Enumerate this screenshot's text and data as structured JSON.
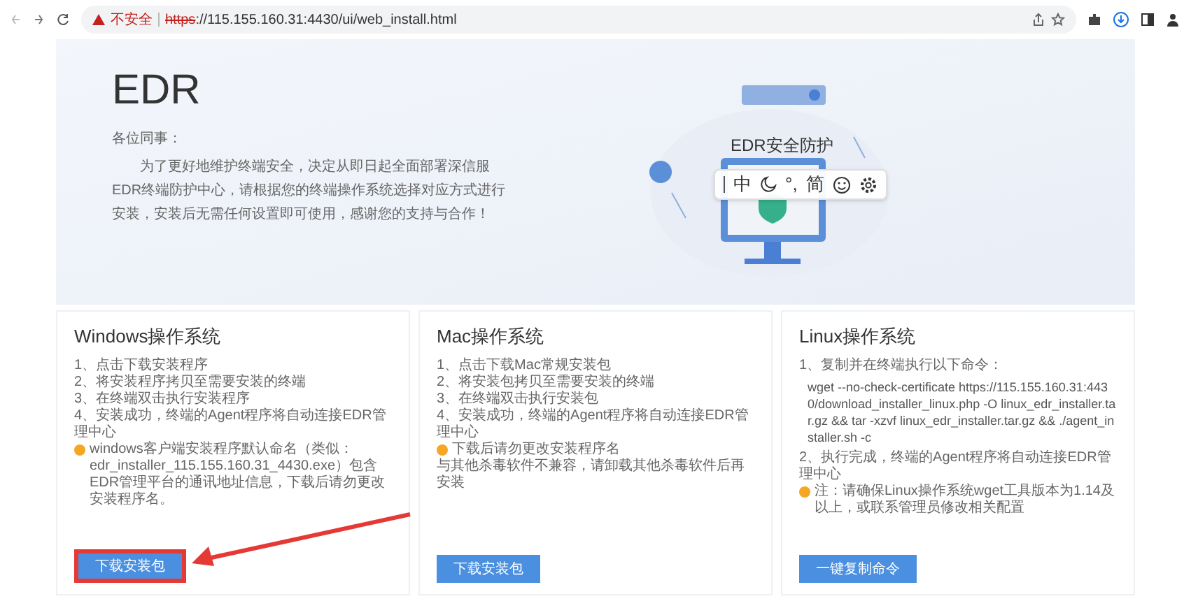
{
  "browser": {
    "security_label": "不安全",
    "scheme": "https",
    "url_rest": "://115.155.160.31:4430/ui/web_install.html"
  },
  "hero": {
    "title": "EDR",
    "greeting": "各位同事：",
    "message": "为了更好地维护终端安全，决定从即日起全面部署深信服EDR终端防护中心，请根据您的终端操作系统选择对应方式进行安装，安装后无需任何设置即可使用，感谢您的支持与合作！",
    "illustration_label": "EDR安全防护"
  },
  "ime_toolbar": {
    "items": [
      "中",
      "°,",
      "简"
    ]
  },
  "cards": [
    {
      "title": "Windows操作系统",
      "lines": [
        {
          "kind": "step",
          "text": "1、点击下载安装程序"
        },
        {
          "kind": "step",
          "text": "2、将安装程序拷贝至需要安装的终端"
        },
        {
          "kind": "step",
          "text": "3、在终端双击执行安装程序"
        },
        {
          "kind": "step",
          "text": "4、安装成功，终端的Agent程序将自动连接EDR管理中心"
        },
        {
          "kind": "note",
          "text": "windows客户端安装程序默认命名（类似：edr_installer_115.155.160.31_4430.exe）包含EDR管理平台的通讯地址信息，下载后请勿更改安装程序名。"
        }
      ],
      "button": "下载安装包",
      "highlighted": true
    },
    {
      "title": "Mac操作系统",
      "lines": [
        {
          "kind": "step",
          "text": "1、点击下载Mac常规安装包"
        },
        {
          "kind": "step",
          "text": "2、将安装包拷贝至需要安装的终端"
        },
        {
          "kind": "step",
          "text": "3、在终端双击执行安装包"
        },
        {
          "kind": "step",
          "text": "4、安装成功，终端的Agent程序将自动连接EDR管理中心"
        },
        {
          "kind": "note",
          "text": "下载后请勿更改安装程序名"
        },
        {
          "kind": "step",
          "text": "与其他杀毒软件不兼容，请卸载其他杀毒软件后再安装"
        }
      ],
      "button": "下载安装包",
      "highlighted": false
    },
    {
      "title": "Linux操作系统",
      "lines": [
        {
          "kind": "step",
          "text": "1、复制并在终端执行以下命令："
        },
        {
          "kind": "command",
          "text": "wget --no-check-certificate https://115.155.160.31:4430/download_installer_linux.php -O linux_edr_installer.tar.gz && tar -xzvf linux_edr_installer.tar.gz && ./agent_installer.sh -c"
        },
        {
          "kind": "step",
          "text": "2、执行完成，终端的Agent程序将自动连接EDR管理中心"
        },
        {
          "kind": "note",
          "text": "注：请确保Linux操作系统wget工具版本为1.14及以上，或联系管理员修改相关配置"
        }
      ],
      "button": "一键复制命令",
      "highlighted": false
    }
  ]
}
